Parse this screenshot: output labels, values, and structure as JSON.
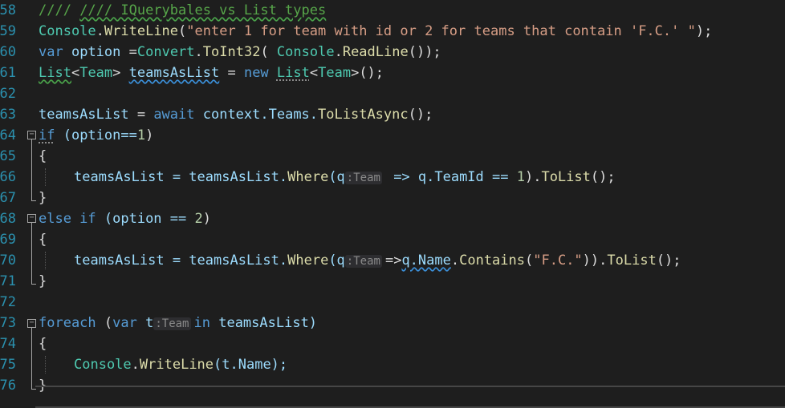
{
  "line_numbers": [
    "58",
    "59",
    "60",
    "61",
    "62",
    "63",
    "64",
    "65",
    "66",
    "67",
    "68",
    "69",
    "70",
    "71",
    "72",
    "73",
    "74",
    "75",
    "76"
  ],
  "fold_glyph": "−",
  "lines": {
    "l58": {
      "comment": "//// IQuerybales vs List types"
    },
    "l59": {
      "obj": "Console",
      "dot": ".",
      "method": "WriteLine",
      "open": "(",
      "string": "\"enter 1 for team with id or 2 for teams that contain 'F.C.' \"",
      "close": ");"
    },
    "l60": {
      "kw": "var",
      "sp1": " ",
      "ident": "option",
      "eq": " =",
      "cls": "Convert",
      "dot": ".",
      "method": "ToInt32",
      "open": "( ",
      "obj2": "Console",
      "dot2": ".",
      "method2": "ReadLine",
      "close": "());"
    },
    "l61": {
      "type1": "List",
      "lt": "<",
      "type2": "Team",
      "gt": "> ",
      "ident": "teamsAsList",
      "eq": " = ",
      "kw": "new",
      "sp": " ",
      "type3": "List",
      "lt2": "<",
      "type4": "Team",
      "end": ">();"
    },
    "l63": {
      "ident": "teamsAsList",
      "eq": " = ",
      "kw": "await",
      "rest": " context.Teams.",
      "method": "ToListAsync",
      "end": "();"
    },
    "l64": {
      "kw": "if",
      "rest": " (option==",
      "num": "1",
      "end": ")"
    },
    "l65": {
      "brace": "{"
    },
    "l66": {
      "ident": "teamsAsList",
      "eq": " = teamsAsList.",
      "method": "Where",
      "open": "(q",
      "hint": ":Team",
      "arrow": " => q.TeamId == ",
      "num": "1",
      "mid": ").",
      "method2": "ToList",
      "end": "();"
    },
    "l67": {
      "brace": "}"
    },
    "l68": {
      "kw": "else if",
      "rest": " (option == ",
      "num": "2",
      "end": ")"
    },
    "l69": {
      "brace": "{"
    },
    "l70": {
      "ident": "teamsAsList",
      "eq": " = teamsAsList.",
      "method": "Where",
      "open": "(q",
      "hint": ":Team",
      "arrow": "=>",
      "qname": "q.Name",
      "dot": ".",
      "method2": "Contains",
      "open2": "(",
      "string": "\"F.C.\"",
      "mid": ")).",
      "method3": "ToList",
      "end": "();"
    },
    "l71": {
      "brace": "}"
    },
    "l73": {
      "kw": "foreach",
      "open": " (",
      "kw2": "var",
      "sp": " t",
      "hint": ":Team",
      "kw3": "in",
      "rest": " teamsAsList)"
    },
    "l74": {
      "brace": "{"
    },
    "l75": {
      "obj": "Console",
      "dot": ".",
      "method": "WriteLine",
      "rest": "(t.Name);"
    },
    "l76": {
      "brace": "}"
    }
  },
  "colors": {
    "background": "#1e1e1e",
    "line_number": "#2b91af",
    "comment": "#57a64a",
    "keyword": "#569cd6",
    "type": "#4ec9b0",
    "method": "#dcdcaa",
    "string": "#d69d85",
    "number": "#b5cea8"
  }
}
